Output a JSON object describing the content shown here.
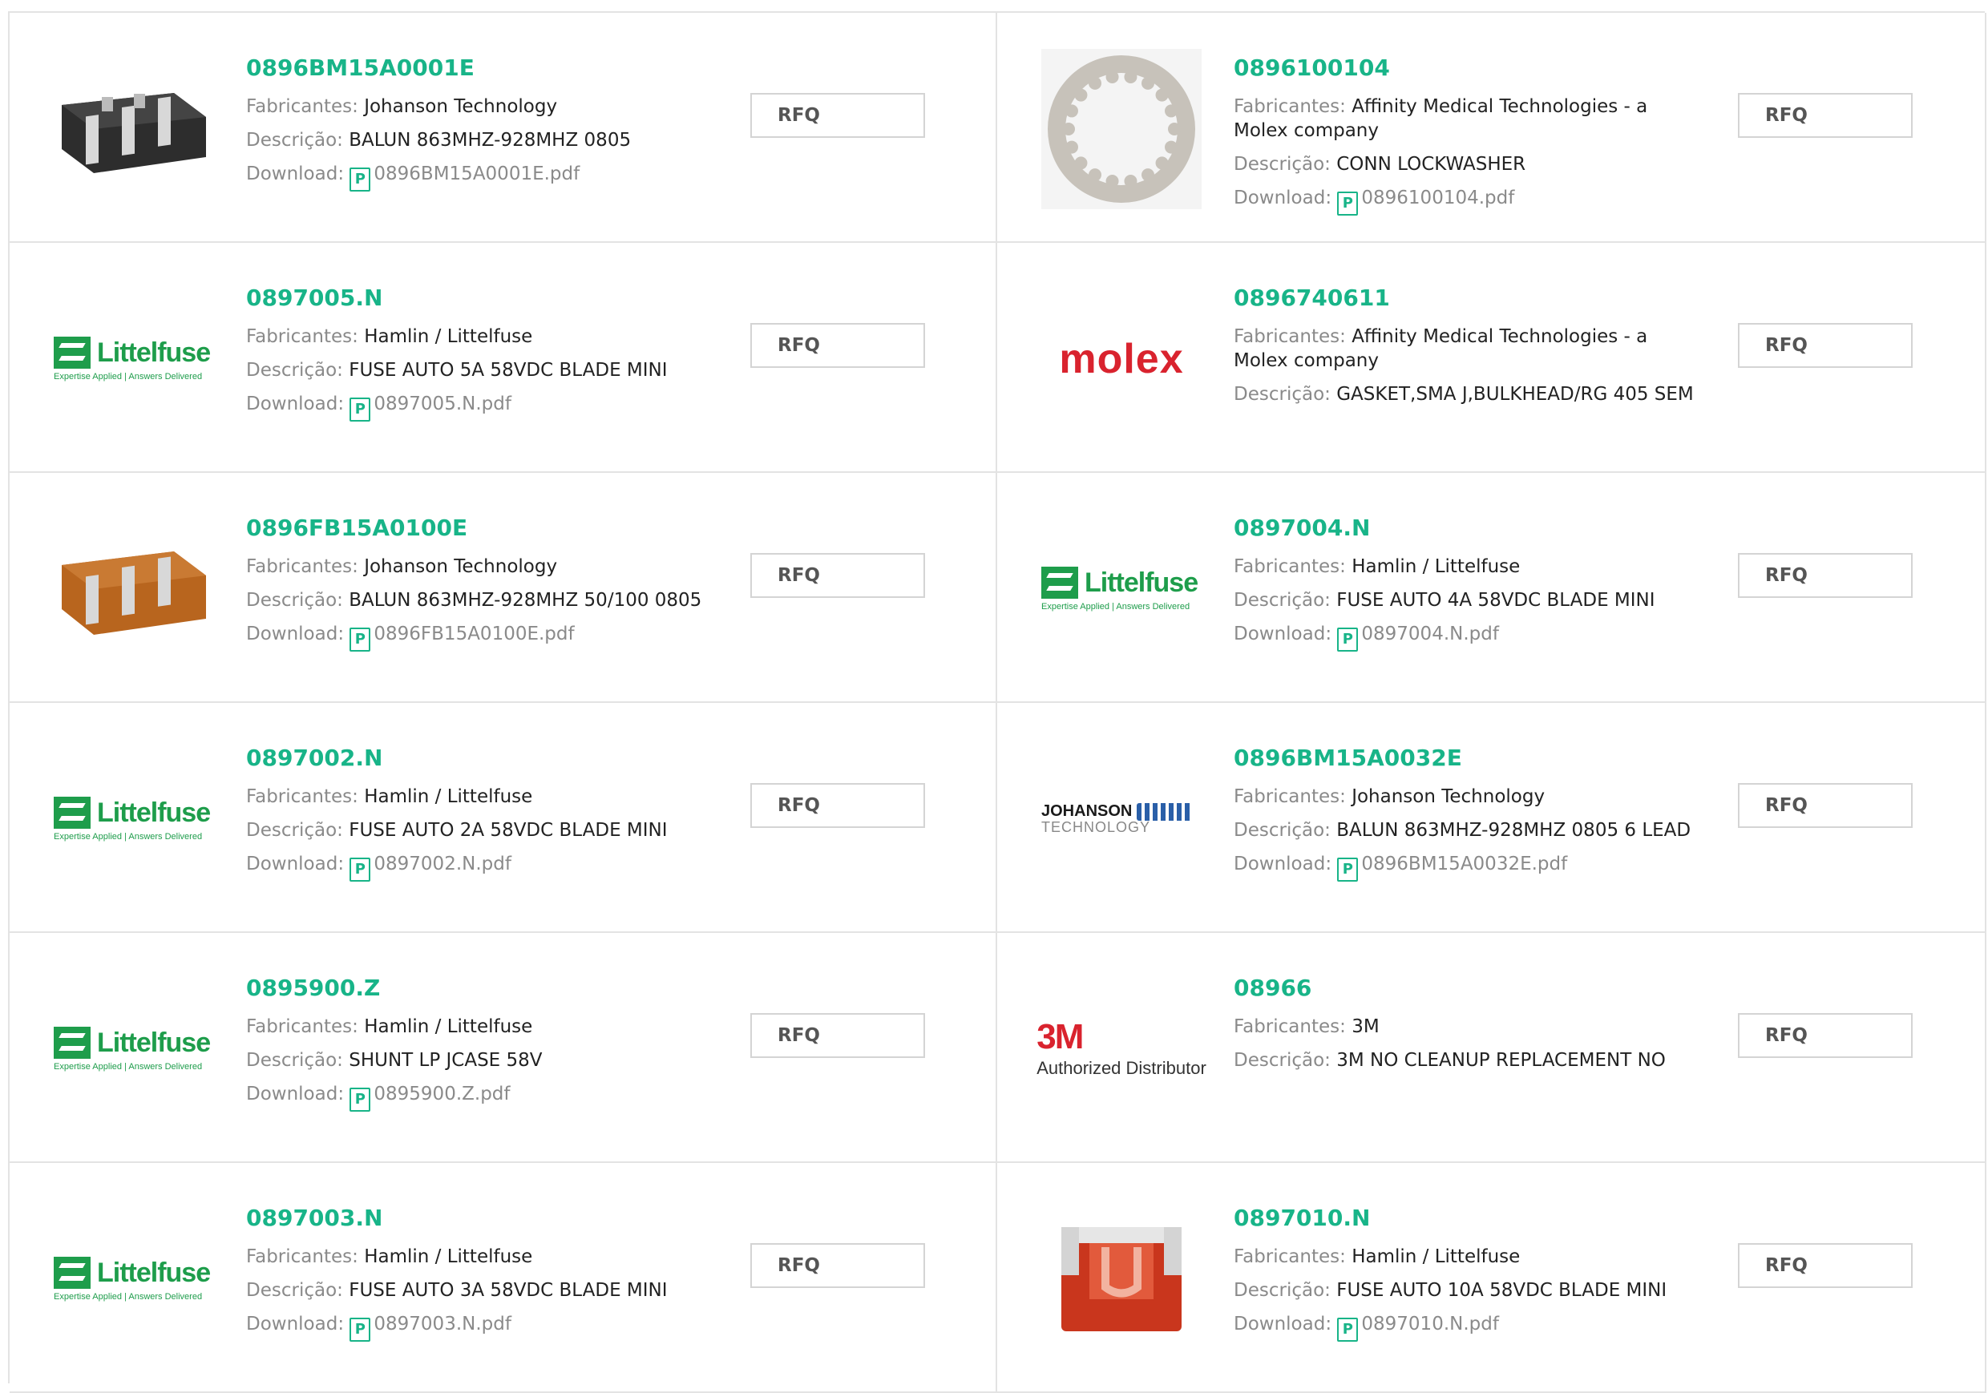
{
  "labels": {
    "manufacturer": "Fabricantes: ",
    "description": "Descrição: ",
    "download": "Download: ",
    "rfq": "RFQ",
    "pdf_icon_glyph": "P"
  },
  "logo_text": {
    "littelfuse_word": "Littelfuse",
    "littelfuse_tag": "Expertise Applied | Answers Delivered",
    "molex_word": "molex",
    "johanson_line1": "JOHANSON",
    "johanson_line2": "TECHNOLOGY",
    "mmm_word": "3M",
    "mmm_sub": "Authorized Distributor"
  },
  "products": [
    {
      "part": "0896BM15A0001E",
      "manufacturer": "Johanson Technology",
      "description": "BALUN 863MHZ-928MHZ 0805",
      "pdf": "0896BM15A0001E.pdf",
      "logo": "chip-black"
    },
    {
      "part": "0896100104",
      "manufacturer": "Affinity Medical Technologies - a Molex company",
      "description": "CONN LOCKWASHER",
      "pdf": "0896100104.pdf",
      "logo": "lockwasher"
    },
    {
      "part": "0897005.N",
      "manufacturer": "Hamlin / Littelfuse",
      "description": "FUSE AUTO 5A 58VDC BLADE MINI",
      "pdf": "0897005.N.pdf",
      "logo": "littelfuse"
    },
    {
      "part": "0896740611",
      "manufacturer": "Affinity Medical Technologies - a Molex company",
      "description": "GASKET,SMA J,BULKHEAD/RG 405 SEM",
      "pdf": "",
      "logo": "molex"
    },
    {
      "part": "0896FB15A0100E",
      "manufacturer": "Johanson Technology",
      "description": "BALUN 863MHZ-928MHZ 50/100 0805",
      "pdf": "0896FB15A0100E.pdf",
      "logo": "chip-brown"
    },
    {
      "part": "0897004.N",
      "manufacturer": "Hamlin / Littelfuse",
      "description": "FUSE AUTO 4A 58VDC BLADE MINI",
      "pdf": "0897004.N.pdf",
      "logo": "littelfuse"
    },
    {
      "part": "0897002.N",
      "manufacturer": "Hamlin / Littelfuse",
      "description": "FUSE AUTO 2A 58VDC BLADE MINI",
      "pdf": "0897002.N.pdf",
      "logo": "littelfuse"
    },
    {
      "part": "0896BM15A0032E",
      "manufacturer": "Johanson Technology",
      "description": "BALUN 863MHZ-928MHZ 0805 6 LEAD",
      "pdf": "0896BM15A0032E.pdf",
      "logo": "johanson"
    },
    {
      "part": "0895900.Z",
      "manufacturer": "Hamlin / Littelfuse",
      "description": "SHUNT LP JCASE 58V",
      "pdf": "0895900.Z.pdf",
      "logo": "littelfuse"
    },
    {
      "part": "08966",
      "manufacturer": "3M",
      "description": "3M NO CLEANUP REPLACEMENT NO",
      "pdf": "",
      "logo": "3m"
    },
    {
      "part": "0897003.N",
      "manufacturer": "Hamlin / Littelfuse",
      "description": "FUSE AUTO 3A 58VDC BLADE MINI",
      "pdf": "0897003.N.pdf",
      "logo": "littelfuse"
    },
    {
      "part": "0897010.N",
      "manufacturer": "Hamlin / Littelfuse",
      "description": "FUSE AUTO 10A 58VDC BLADE MINI",
      "pdf": "0897010.N.pdf",
      "logo": "fuse-red"
    }
  ]
}
